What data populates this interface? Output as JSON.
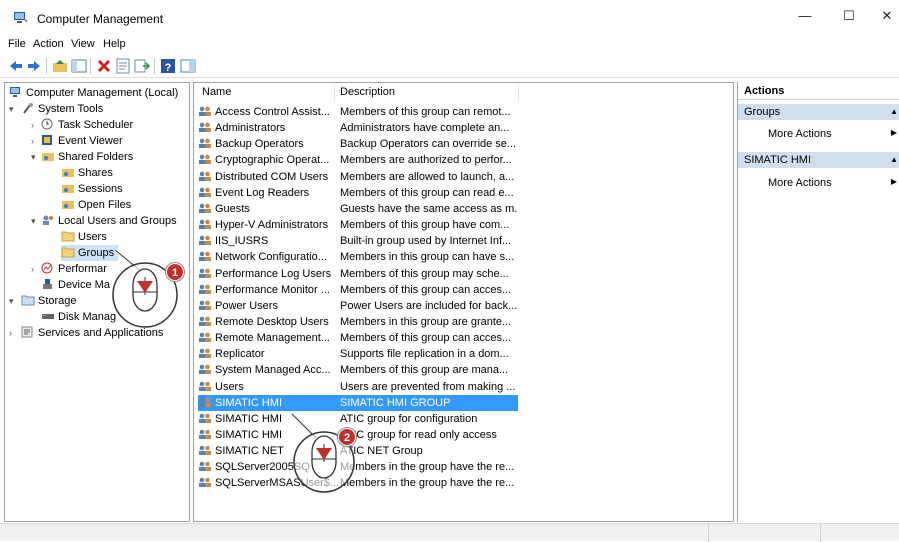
{
  "window": {
    "title": "Computer Management",
    "minimize": "—",
    "maximize": "☐",
    "close": "✕"
  },
  "menu": [
    "File",
    "Action",
    "View",
    "Help"
  ],
  "tree": {
    "root": "Computer Management (Local)",
    "system_tools": "System Tools",
    "task_scheduler": "Task Scheduler",
    "event_viewer": "Event Viewer",
    "shared_folders": "Shared Folders",
    "shares": "Shares",
    "sessions": "Sessions",
    "open_files": "Open Files",
    "local_users_groups": "Local Users and Groups",
    "users": "Users",
    "groups": "Groups",
    "performance": "Performar",
    "device_manager": "Device Ma",
    "storage": "Storage",
    "disk_management": "Disk Manag",
    "services_apps": "Services and Applications"
  },
  "list": {
    "headers": {
      "name": "Name",
      "description": "Description"
    },
    "rows": [
      {
        "name": "Access Control Assist...",
        "desc": "Members of this group can remot..."
      },
      {
        "name": "Administrators",
        "desc": "Administrators have complete an..."
      },
      {
        "name": "Backup Operators",
        "desc": "Backup Operators can override se..."
      },
      {
        "name": "Cryptographic Operat...",
        "desc": "Members are authorized to perfor..."
      },
      {
        "name": "Distributed COM Users",
        "desc": "Members are allowed to launch, a..."
      },
      {
        "name": "Event Log Readers",
        "desc": "Members of this group can read e..."
      },
      {
        "name": "Guests",
        "desc": "Guests have the same access as m..."
      },
      {
        "name": "Hyper-V Administrators",
        "desc": "Members of this group have com..."
      },
      {
        "name": "IIS_IUSRS",
        "desc": "Built-in group used by Internet Inf..."
      },
      {
        "name": "Network Configuratio...",
        "desc": "Members in this group can have s..."
      },
      {
        "name": "Performance Log Users",
        "desc": "Members of this group may sche..."
      },
      {
        "name": "Performance Monitor ...",
        "desc": "Members of this group can acces..."
      },
      {
        "name": "Power Users",
        "desc": "Power Users are included for back..."
      },
      {
        "name": "Remote Desktop Users",
        "desc": "Members in this group are grante..."
      },
      {
        "name": "Remote Management...",
        "desc": "Members of this group can acces..."
      },
      {
        "name": "Replicator",
        "desc": "Supports file replication in a dom..."
      },
      {
        "name": "System Managed Acc...",
        "desc": "Members of this group are mana..."
      },
      {
        "name": "Users",
        "desc": "Users are prevented from making ..."
      },
      {
        "name": "SIMATIC HMI",
        "desc": "SIMATIC HMI GROUP"
      },
      {
        "name": "SIMATIC HMI",
        "desc": "ATIC group for configuration"
      },
      {
        "name": "SIMATIC HMI",
        "desc": "ATIC group for read only access"
      },
      {
        "name": "SIMATIC NET",
        "desc": "ATIC NET Group"
      },
      {
        "name": "SQLServer2005SQ",
        "desc": "Members in the group have the re..."
      },
      {
        "name": "SQLServerMSASUser$...",
        "desc": "Members in the group have the re..."
      }
    ]
  },
  "actions": {
    "title": "Actions",
    "groups_header": "Groups",
    "groups_more": "More Actions",
    "simatic_header": "SIMATIC HMI",
    "simatic_more": "More Actions"
  },
  "callouts": {
    "step1": "1",
    "step2": "2"
  },
  "colors": {
    "selection": "#3399ff",
    "callout": "#c0302c",
    "action_header": "#cfdff0"
  }
}
